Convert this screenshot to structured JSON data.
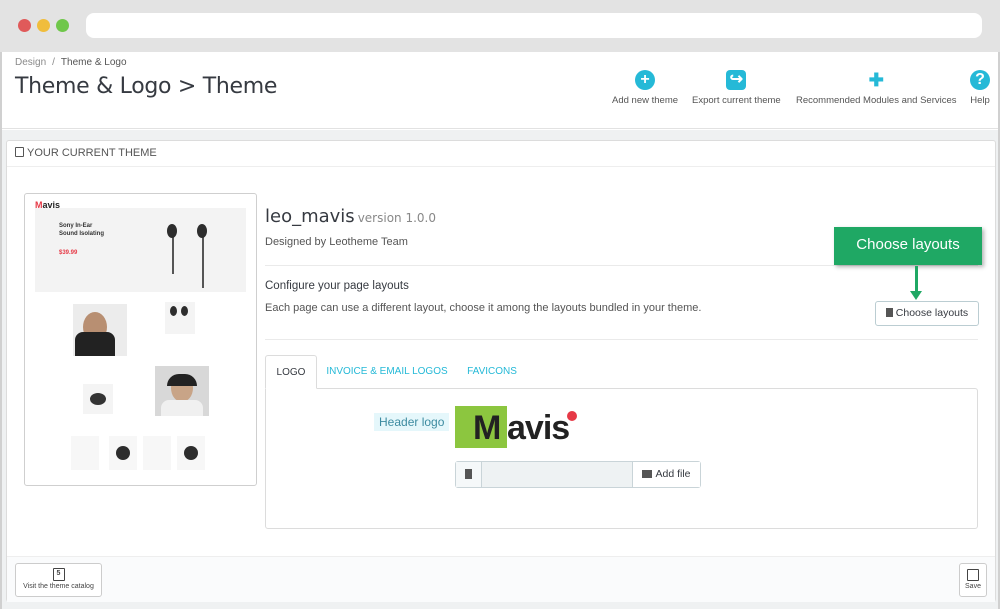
{
  "breadcrumb": {
    "parent": "Design",
    "separator": "/",
    "current": "Theme & Logo"
  },
  "page_title": "Theme & Logo > Theme",
  "toolbar": {
    "add_theme": "Add new theme",
    "export_theme": "Export current theme",
    "recommended": "Recommended Modules and Services",
    "help": "Help",
    "help_glyph": "?",
    "add_glyph": "+"
  },
  "panel": {
    "heading": "YOUR CURRENT THEME"
  },
  "thumbnail": {
    "brand_mark": "M",
    "brand_rest": "avis",
    "hero_title_1": "Sony In-Ear",
    "hero_title_2": "Sound Isolating",
    "hero_price": "$39.99"
  },
  "theme": {
    "name": "leo_mavis",
    "version": "version 1.0.0",
    "designed_by": "Designed by Leotheme Team"
  },
  "layouts": {
    "title": "Configure your page layouts",
    "description": "Each page can use a different layout, choose it among the layouts bundled in your theme.",
    "button": "Choose layouts",
    "callout": "Choose layouts"
  },
  "tabs": [
    {
      "label": "LOGO",
      "active": true
    },
    {
      "label": "INVOICE & EMAIL LOGOS",
      "active": false
    },
    {
      "label": "FAVICONS",
      "active": false
    }
  ],
  "logo_tab": {
    "header_logo_label": "Header logo",
    "logo_m": "M",
    "logo_rest": "avis",
    "add_file": "Add file"
  },
  "footer": {
    "catalog_button": "Visit the theme catalog",
    "catalog_glyph": "5",
    "save_button": "Save"
  },
  "colors": {
    "accent": "#25b9d7",
    "callout": "#1fa864",
    "logo_green": "#8cc63f",
    "logo_red": "#e63946"
  }
}
